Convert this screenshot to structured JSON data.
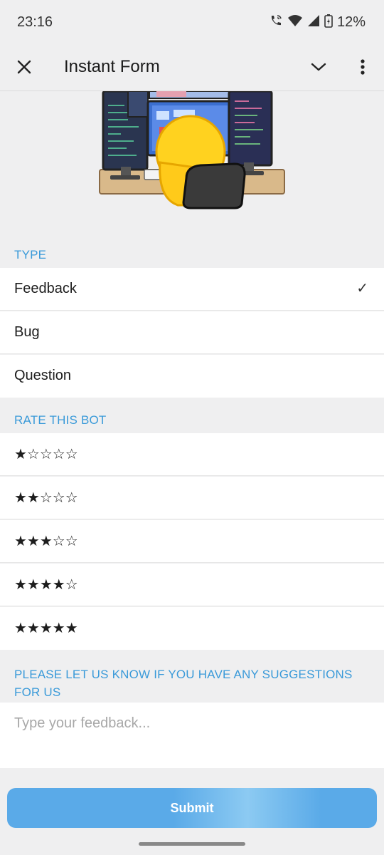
{
  "status_bar": {
    "time": "23:16",
    "battery": "12%",
    "icons": [
      "call-wifi-icon",
      "wifi-icon",
      "signal-icon",
      "battery-charging-icon"
    ]
  },
  "app_bar": {
    "title": "Instant Form",
    "close_icon": "close-icon",
    "expand_icon": "chevron-down-icon",
    "menu_icon": "more-vert-icon"
  },
  "sections": {
    "type": {
      "header": "TYPE",
      "options": [
        {
          "label": "Feedback",
          "selected": true
        },
        {
          "label": "Bug",
          "selected": false
        },
        {
          "label": "Question",
          "selected": false
        }
      ],
      "check_mark": "✓"
    },
    "rating": {
      "header": "RATE THIS BOT",
      "options": [
        {
          "stars": "★☆☆☆☆",
          "value": 1
        },
        {
          "stars": "★★☆☆☆",
          "value": 2
        },
        {
          "stars": "★★★☆☆",
          "value": 3
        },
        {
          "stars": "★★★★☆",
          "value": 4
        },
        {
          "stars": "★★★★★",
          "value": 5
        }
      ]
    },
    "suggestions": {
      "header": "PLEASE LET US KNOW IF YOU HAVE ANY SUGGESTIONS FOR US",
      "placeholder": "Type your feedback...",
      "value": ""
    }
  },
  "submit_label": "Submit",
  "colors": {
    "background": "#efeff0",
    "accent": "#3a9ad9",
    "button": "#5aaae8"
  }
}
